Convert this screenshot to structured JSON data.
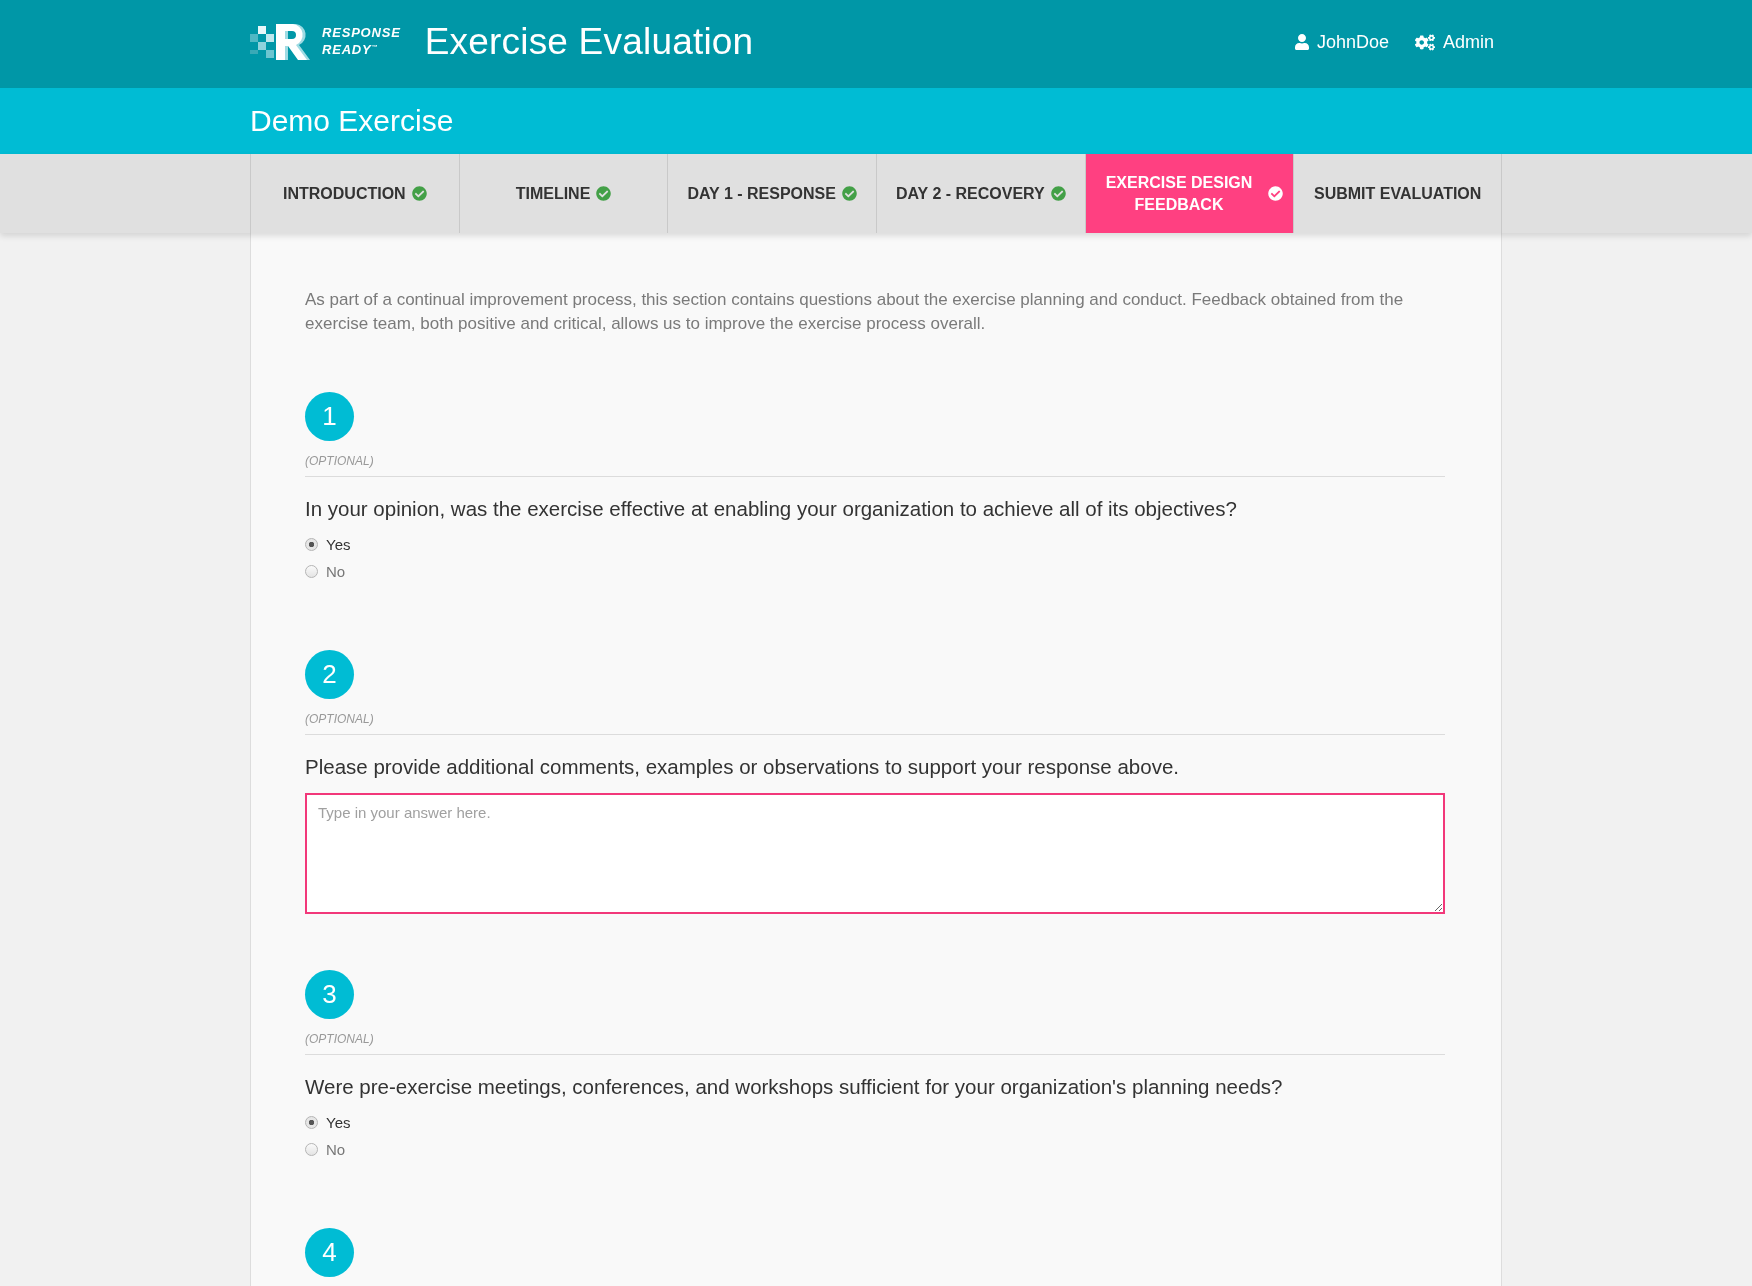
{
  "header": {
    "logo_lines": [
      "RESPONSE",
      "READY$^{™}$"
    ],
    "title": "Exercise Evaluation",
    "nav": [
      {
        "kind": "user",
        "label": "JohnDoe"
      },
      {
        "kind": "admin",
        "label": "Admin"
      }
    ]
  },
  "exercise_title": "Demo Exercise",
  "tabs": [
    {
      "label": "INTRODUCTION",
      "selected": false,
      "completed": true
    },
    {
      "label": "TIMELINE",
      "selected": false,
      "completed": true
    },
    {
      "label": "DAY 1 - RESPONSE",
      "selected": false,
      "completed": true
    },
    {
      "label": "DAY 2 - RECOVERY",
      "selected": false,
      "completed": true
    },
    {
      "label": "EXERCISE DESIGN FEEDBACK",
      "selected": true,
      "completed": true
    },
    {
      "label": "SUBMIT EVALUATION",
      "selected": false,
      "completed": false
    }
  ],
  "intro": "As part of a continual improvement process, this section contains questions about the exercise planning and conduct. Feedback obtained from the exercise team, both positive and critical, allows us to improve the exercise process overall.",
  "questions": [
    {
      "number": "1",
      "optional": "(OPTIONAL)",
      "text": "In your opinion, was the exercise effective at enabling your organization to achieve all of its objectives?",
      "kind": "radio",
      "options": [
        {
          "label": "Yes",
          "selected": true
        },
        {
          "label": "No",
          "selected": false
        }
      ]
    },
    {
      "number": "2",
      "optional": "(OPTIONAL)",
      "text": "Please provide additional comments, examples or observations to support your response above.",
      "kind": "text",
      "placeholder": "Type in your answer here.",
      "focused": true
    },
    {
      "number": "3",
      "optional": "(OPTIONAL)",
      "text": "Were pre-exercise meetings, conferences, and workshops sufficient for your organization's planning needs?",
      "kind": "radio",
      "options": [
        {
          "label": "Yes",
          "selected": true
        },
        {
          "label": "No",
          "selected": false
        }
      ]
    },
    {
      "number": "4"
    }
  ]
}
